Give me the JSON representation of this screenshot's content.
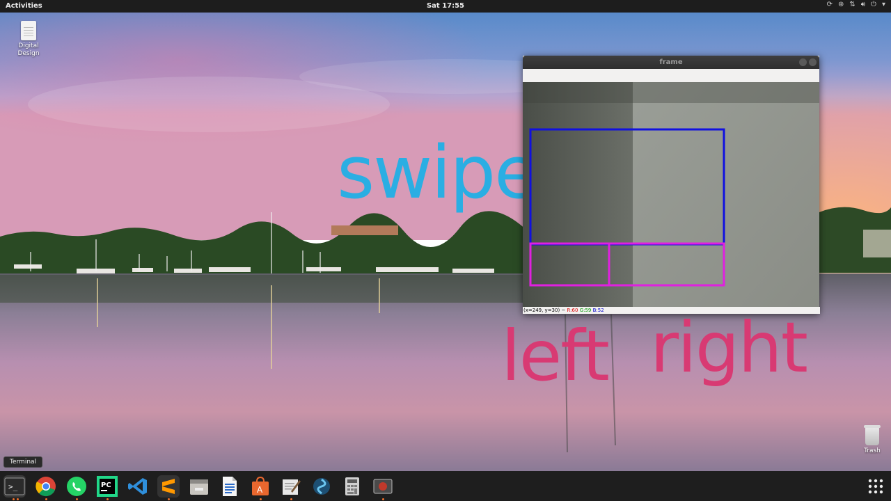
{
  "topbar": {
    "activities": "Activities",
    "clock": "Sat 17:55"
  },
  "desktop": {
    "icons": [
      {
        "label": "Digital\nDesign",
        "icon": "document-icon"
      },
      {
        "label": "Trash",
        "icon": "trash-icon"
      }
    ],
    "overlay_words": {
      "swipe": "swipe",
      "left": "left",
      "right": "right"
    },
    "overlay_colors": {
      "swipe": "#2aaee3",
      "left_right": "#d83a73"
    }
  },
  "frame_window": {
    "title": "frame",
    "status": {
      "coords": "(x=249, y=30) ~",
      "r": "R:60",
      "g": "G:59",
      "b": "B:52"
    },
    "overlay_colors": {
      "region_box": "#1010e0",
      "swipe_zones": "#e020e0"
    }
  },
  "dock": {
    "tooltip": "Terminal",
    "apps": [
      {
        "name": "terminal-icon",
        "running": true
      },
      {
        "name": "chrome-icon",
        "running": true
      },
      {
        "name": "whatsapp-icon",
        "running": true
      },
      {
        "name": "pycharm-icon",
        "running": true
      },
      {
        "name": "vscode-icon",
        "running": false
      },
      {
        "name": "sublime-text-icon",
        "running": true
      },
      {
        "name": "files-icon",
        "running": false
      },
      {
        "name": "writer-icon",
        "running": false
      },
      {
        "name": "software-center-icon",
        "running": true
      },
      {
        "name": "text-editor-icon",
        "running": true
      },
      {
        "name": "shotwell-icon",
        "running": false
      },
      {
        "name": "calculator-icon",
        "running": false
      },
      {
        "name": "screen-recorder-icon",
        "running": true
      },
      {
        "name": "show-apps-icon",
        "running": false
      }
    ]
  }
}
